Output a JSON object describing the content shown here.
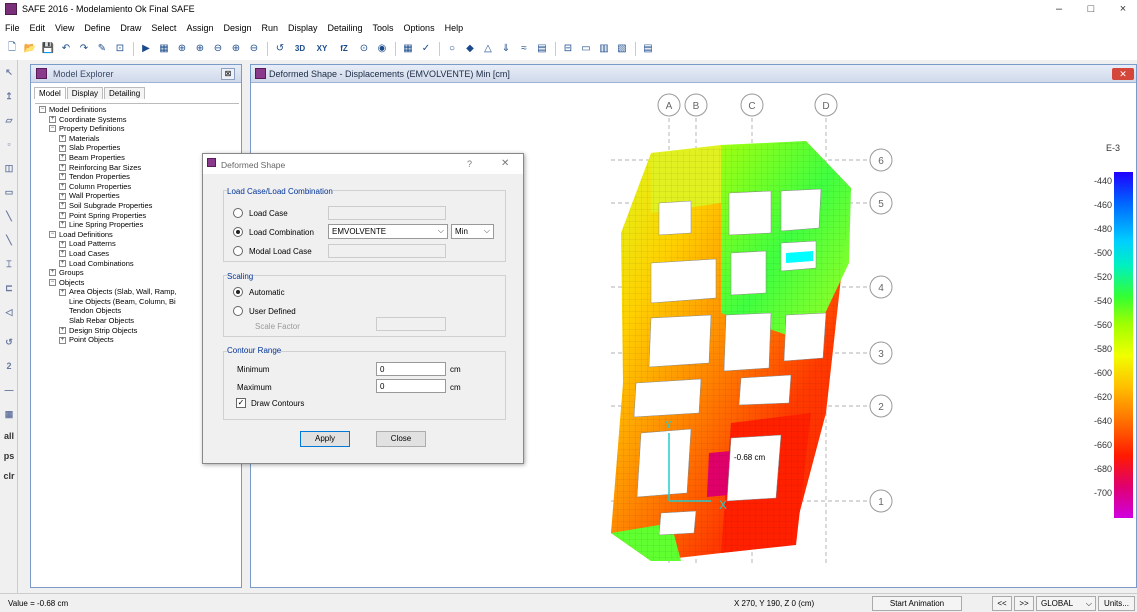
{
  "app": {
    "title": "SAFE 2016 - Modelamiento Ok Final SAFE",
    "minimize": "–",
    "maximize": "□",
    "close": "×"
  },
  "menu": [
    "File",
    "Edit",
    "View",
    "Define",
    "Draw",
    "Select",
    "Assign",
    "Design",
    "Run",
    "Display",
    "Detailing",
    "Tools",
    "Options",
    "Help"
  ],
  "toolbar": {
    "icons": [
      "new-file-icon",
      "open-folder-icon",
      "save-icon",
      "undo-icon",
      "redo-icon",
      "pencil-icon",
      "lock-icon",
      "sep",
      "run-icon",
      "pan-icon",
      "zoom-icon",
      "zoom-in-icon",
      "zoom-out-icon",
      "zoom-window-icon",
      "zoom-prev-icon",
      "sep",
      "refresh-icon"
    ],
    "view_labels": [
      "3D",
      "XY",
      "fZ"
    ],
    "icons_after": [
      "perspective-icon",
      "eye-icon",
      "sep",
      "grid-icon",
      "check-icon",
      "sep",
      "circle-icon",
      "shape-icon",
      "triangle-icon",
      "load-icon",
      "stiff-icon",
      "table-icon",
      "sep",
      "display-icon",
      "zoom-fit-icon",
      "chart-icon",
      "chart2-icon",
      "sep",
      "table2-icon"
    ]
  },
  "left_toolbar": [
    "pointer-icon",
    "pin-icon",
    "plane-icon",
    "blank-icon",
    "node-icon",
    "sheet-icon",
    "line-icon",
    "diag-icon",
    "column-icon",
    "wall-icon",
    "beam-icon",
    "sep",
    "refresh-icon",
    "2-label",
    "dash-icon",
    "grid-icon"
  ],
  "left_toolbar_labels": [
    "all",
    "ps",
    "clr"
  ],
  "explorer": {
    "title": "Model Explorer",
    "close_btn": "⊠",
    "tabs": [
      "Model",
      "Display",
      "Detailing"
    ],
    "tree": [
      {
        "d": 0,
        "e": "−",
        "t": "Model Definitions"
      },
      {
        "d": 1,
        "e": "+",
        "t": "Coordinate Systems"
      },
      {
        "d": 1,
        "e": "−",
        "t": "Property Definitions"
      },
      {
        "d": 2,
        "e": "+",
        "t": "Materials"
      },
      {
        "d": 2,
        "e": "+",
        "t": "Slab Properties"
      },
      {
        "d": 2,
        "e": "+",
        "t": "Beam Properties"
      },
      {
        "d": 2,
        "e": "+",
        "t": "Reinforcing Bar Sizes"
      },
      {
        "d": 2,
        "e": "+",
        "t": "Tendon Properties"
      },
      {
        "d": 2,
        "e": "+",
        "t": "Column Properties"
      },
      {
        "d": 2,
        "e": "+",
        "t": "Wall Properties"
      },
      {
        "d": 2,
        "e": "+",
        "t": "Soil Subgrade Properties"
      },
      {
        "d": 2,
        "e": "+",
        "t": "Point Spring Properties"
      },
      {
        "d": 2,
        "e": "+",
        "t": "Line Spring Properties"
      },
      {
        "d": 1,
        "e": "−",
        "t": "Load Definitions"
      },
      {
        "d": 2,
        "e": "+",
        "t": "Load Patterns"
      },
      {
        "d": 2,
        "e": "+",
        "t": "Load Cases"
      },
      {
        "d": 2,
        "e": "+",
        "t": "Load Combinations"
      },
      {
        "d": 1,
        "e": "+",
        "t": "Groups"
      },
      {
        "d": 1,
        "e": "−",
        "t": "Objects"
      },
      {
        "d": 2,
        "e": "+",
        "t": "Area Objects (Slab, Wall, Ramp,"
      },
      {
        "d": 2,
        "e": "",
        "t": "Line Objects (Beam, Column, Bi"
      },
      {
        "d": 2,
        "e": "",
        "t": "Tendon Objects"
      },
      {
        "d": 2,
        "e": "",
        "t": "Slab Rebar Objects"
      },
      {
        "d": 2,
        "e": "+",
        "t": "Design Strip Objects"
      },
      {
        "d": 2,
        "e": "+",
        "t": "Point Objects"
      }
    ]
  },
  "main_window": {
    "title": "Deformed Shape - Displacements (EMVOLVENTE)  Min  [cm]",
    "close": "✕",
    "grid_letters": [
      "A",
      "B",
      "C",
      "D"
    ],
    "grid_numbers": [
      "6",
      "5",
      "4",
      "3",
      "2",
      "1"
    ],
    "point_label": "-0.68 cm",
    "x_axis_label": "X",
    "y_axis_label": "Y"
  },
  "legend": {
    "exponent": "E-3",
    "values": [
      "-440",
      "-460",
      "-480",
      "-500",
      "-520",
      "-540",
      "-560",
      "-580",
      "-600",
      "-620",
      "-640",
      "-660",
      "-680",
      "-700"
    ]
  },
  "dialog": {
    "title": "Deformed Shape",
    "help": "?",
    "close": "✕",
    "load_group": "Load Case/Load Combination",
    "load_case": "Load Case",
    "load_combination": "Load Combination",
    "load_combination_value": "EMVOLVENTE",
    "minmax_value": "Min",
    "modal_load_case": "Modal Load Case",
    "selected_load_option": "load_combination",
    "scaling_group": "Scaling",
    "automatic": "Automatic",
    "user_defined": "User Defined",
    "scale_factor": "Scale Factor",
    "selected_scaling": "automatic",
    "contour_group": "Contour Range",
    "minimum_label": "Minimum",
    "minimum_value": "0",
    "maximum_label": "Maximum",
    "maximum_value": "0",
    "unit": "cm",
    "draw_contours": "Draw Contours",
    "draw_contours_checked": true,
    "apply": "Apply",
    "close_btn": "Close"
  },
  "status": {
    "value": "Value = -0.68 cm",
    "coords": "X 270,  Y 190,  Z 0  (cm)",
    "start_animation": "Start Animation",
    "prev": "<<",
    "next": ">>",
    "coord_system": "GLOBAL",
    "units": "Units..."
  },
  "colors": {
    "accent": "#0078d7",
    "window_border": "#7a9ac8",
    "close_red": "#d4453a"
  }
}
